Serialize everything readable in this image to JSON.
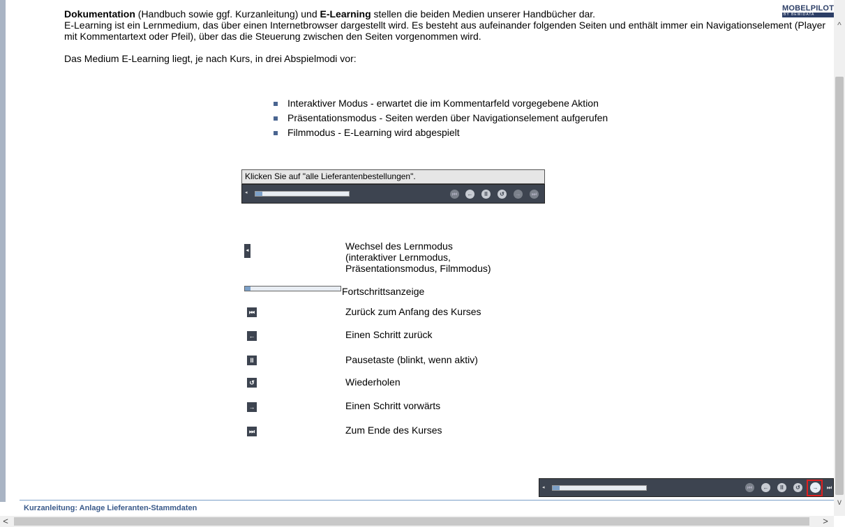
{
  "logo": {
    "line1": "MOBELPILOT",
    "line2": "BY BEWIDATA"
  },
  "intro": {
    "p1_bold1": "Dokumentation",
    "p1_text1": " (Handbuch sowie ggf. Kurzanleitung) und ",
    "p1_bold2": "E-Learning",
    "p1_text2": " stellen die beiden Medien unserer Handbücher dar.",
    "p2": "E-Learning ist ein Lernmedium, das über einen Internetbrowser dargestellt wird. Es besteht aus aufeinander folgenden Seiten und enthält immer ein Navigationselement (Player mit Kommentartext oder Pfeil), über das die Steuerung zwischen den Seiten vorgenommen wird.",
    "p3": "Das Medium E-Learning liegt, je nach Kurs, in drei Abspielmodi vor:"
  },
  "modes": [
    "Interaktiver Modus - erwartet die im Kommentarfeld vorgegebene Aktion",
    "Präsentationsmodus - Seiten werden über Navigationselement aufgerufen",
    "Filmmodus - E-Learning wird abgespielt"
  ],
  "demo_player": {
    "comment": "Klicken Sie auf \"alle Lieferantenbestellungen\"."
  },
  "legend": {
    "mode_switch": "Wechsel des Lernmodus\n(interaktiver Lernmodus,\nPräsentationsmodus, Filmmodus)",
    "progress": "Fortschrittsanzeige",
    "to_start": "Zurück zum Anfang des Kurses",
    "step_back": "Einen Schritt zurück",
    "pause": "Pausetaste (blinkt, wenn aktiv)",
    "repeat": "Wiederholen",
    "step_forward": "Einen Schritt vorwärts",
    "to_end": "Zum Ende des Kurses"
  },
  "icons": {
    "mode": "mode-switch-icon",
    "first": "skip-to-start-icon",
    "back": "arrow-left-icon",
    "pause": "pause-icon",
    "repeat": "repeat-icon",
    "forward": "arrow-right-icon",
    "last": "skip-to-end-icon"
  },
  "footer": {
    "title": "Kurzanleitung: Anlage Lieferanten-Stammdaten"
  },
  "colors": {
    "player_bg": "#3d4450",
    "accent": "#3a5a8a",
    "highlight": "#e02020"
  }
}
